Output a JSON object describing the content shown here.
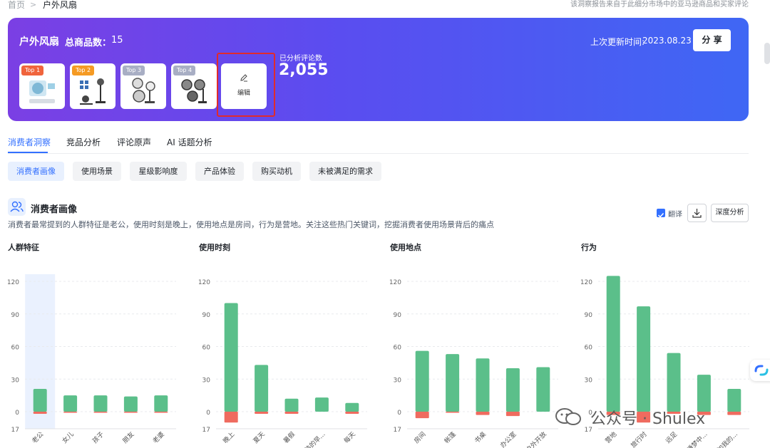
{
  "breadcrumb": {
    "home": "首页",
    "current": "户外风扇"
  },
  "top_note": "该洞察报告来自于此细分市场中的亚马逊商品和买家评论",
  "hero": {
    "title": "户外风扇",
    "count_label": "总商品数：",
    "count_value": "15",
    "update_label": "上次更新时间:",
    "update_value": "2023.08.23",
    "share_label": "分 享",
    "products": [
      {
        "rank": "Top 1",
        "icon": "fan-product-1"
      },
      {
        "rank": "Top 2",
        "icon": "fan-product-2"
      },
      {
        "rank": "Top 3",
        "icon": "fan-product-3"
      },
      {
        "rank": "Top 4",
        "icon": "fan-product-4"
      }
    ],
    "edit_label": "编辑",
    "analyzed_label": "已分析评论数",
    "analyzed_value": "2,055"
  },
  "tabs": [
    "消费者洞察",
    "竞品分析",
    "评论原声",
    "AI 话题分析"
  ],
  "subtabs": [
    "消费者画像",
    "使用场景",
    "星级影响度",
    "产品体验",
    "购买动机",
    "未被满足的需求"
  ],
  "section": {
    "title": "消费者画像",
    "description": "消费者最常提到的人群特征是老公，使用时刻是晚上，使用地点是房间，行为是营地。关注这些热门关键词，挖掘消费者使用场景背后的痛点",
    "translate_label": "翻译",
    "deep_label": "深度分析"
  },
  "colors": {
    "positive": "#5bbf8a",
    "negative": "#ef6b5f",
    "accent": "#3370ff",
    "highlight": "#eaf1fe"
  },
  "chart_data": [
    {
      "type": "bar",
      "title": "人群特征",
      "categories": [
        "老公",
        "女儿",
        "孩子",
        "朋友",
        "老婆"
      ],
      "series": [
        {
          "values": [
            21,
            15,
            15,
            14,
            15
          ]
        },
        {
          "values": [
            -2,
            -1,
            -1,
            -1,
            -1
          ]
        }
      ],
      "y_ticks_upper": [
        "120",
        "90",
        "60",
        "30",
        "0"
      ],
      "y_tick_lower": "17",
      "highlighted_category": "老公"
    },
    {
      "type": "bar",
      "title": "使用时刻",
      "categories": [
        "晚上",
        "夏天",
        "暑假",
        "炎热的早...",
        "每天"
      ],
      "series": [
        {
          "values": [
            100,
            43,
            12,
            13,
            8
          ]
        },
        {
          "values": [
            -10,
            -2,
            -2,
            0,
            -2
          ]
        }
      ],
      "y_ticks_upper": [
        "120",
        "90",
        "60",
        "30",
        "0"
      ],
      "y_tick_lower": "17"
    },
    {
      "type": "bar",
      "title": "使用地点",
      "categories": [
        "房间",
        "帐篷",
        "书桌",
        "办公室",
        "户外开放"
      ],
      "series": [
        {
          "values": [
            56,
            53,
            49,
            40,
            41
          ]
        },
        {
          "values": [
            -6,
            -1,
            -3,
            -4,
            0
          ]
        }
      ],
      "y_ticks_upper": [
        "120",
        "90",
        "60",
        "30",
        "0"
      ],
      "y_tick_lower": "17"
    },
    {
      "type": "bar",
      "title": "行为",
      "categories": [
        "营地",
        "旅行时",
        "远足",
        "在睡梦中...",
        "参加我的..."
      ],
      "series": [
        {
          "values": [
            125,
            97,
            54,
            34,
            21
          ]
        },
        {
          "values": [
            -3,
            -10,
            -2,
            -3,
            -3
          ]
        }
      ],
      "y_ticks_upper": [
        "120",
        "90",
        "60",
        "30",
        "0"
      ],
      "y_tick_lower": "17"
    }
  ],
  "watermark": "公众号 · Shulex"
}
